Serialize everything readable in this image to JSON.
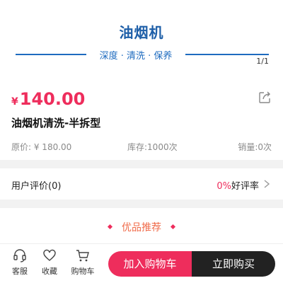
{
  "banner": {
    "title": "油烟机",
    "subtitle": "深度 · 清洗 · 保养",
    "pager": "1/1"
  },
  "product": {
    "currency": "¥",
    "price": "140.00",
    "title": "油烟机清洗-半拆型",
    "original_price": "原价: ¥ 180.00",
    "stock": "库存:1000次",
    "sales": "销量:0次"
  },
  "review": {
    "label": "用户评价(0)",
    "rate_value": "0%",
    "rate_label": "好评率"
  },
  "recommend": {
    "title": "优品推荐"
  },
  "bottom_bar": {
    "service_label": "客服",
    "favorite_label": "收藏",
    "cart_label": "购物车",
    "add_to_cart_label": "加入购物车",
    "buy_now_label": "立即购买"
  },
  "colors": {
    "accent": "#ee2d5c",
    "banner_blue": "#1e6bbf",
    "buy_button": "#222222"
  },
  "icons": [
    "share-icon",
    "chevron-right-icon",
    "headset-icon",
    "heart-icon",
    "cart-icon"
  ]
}
